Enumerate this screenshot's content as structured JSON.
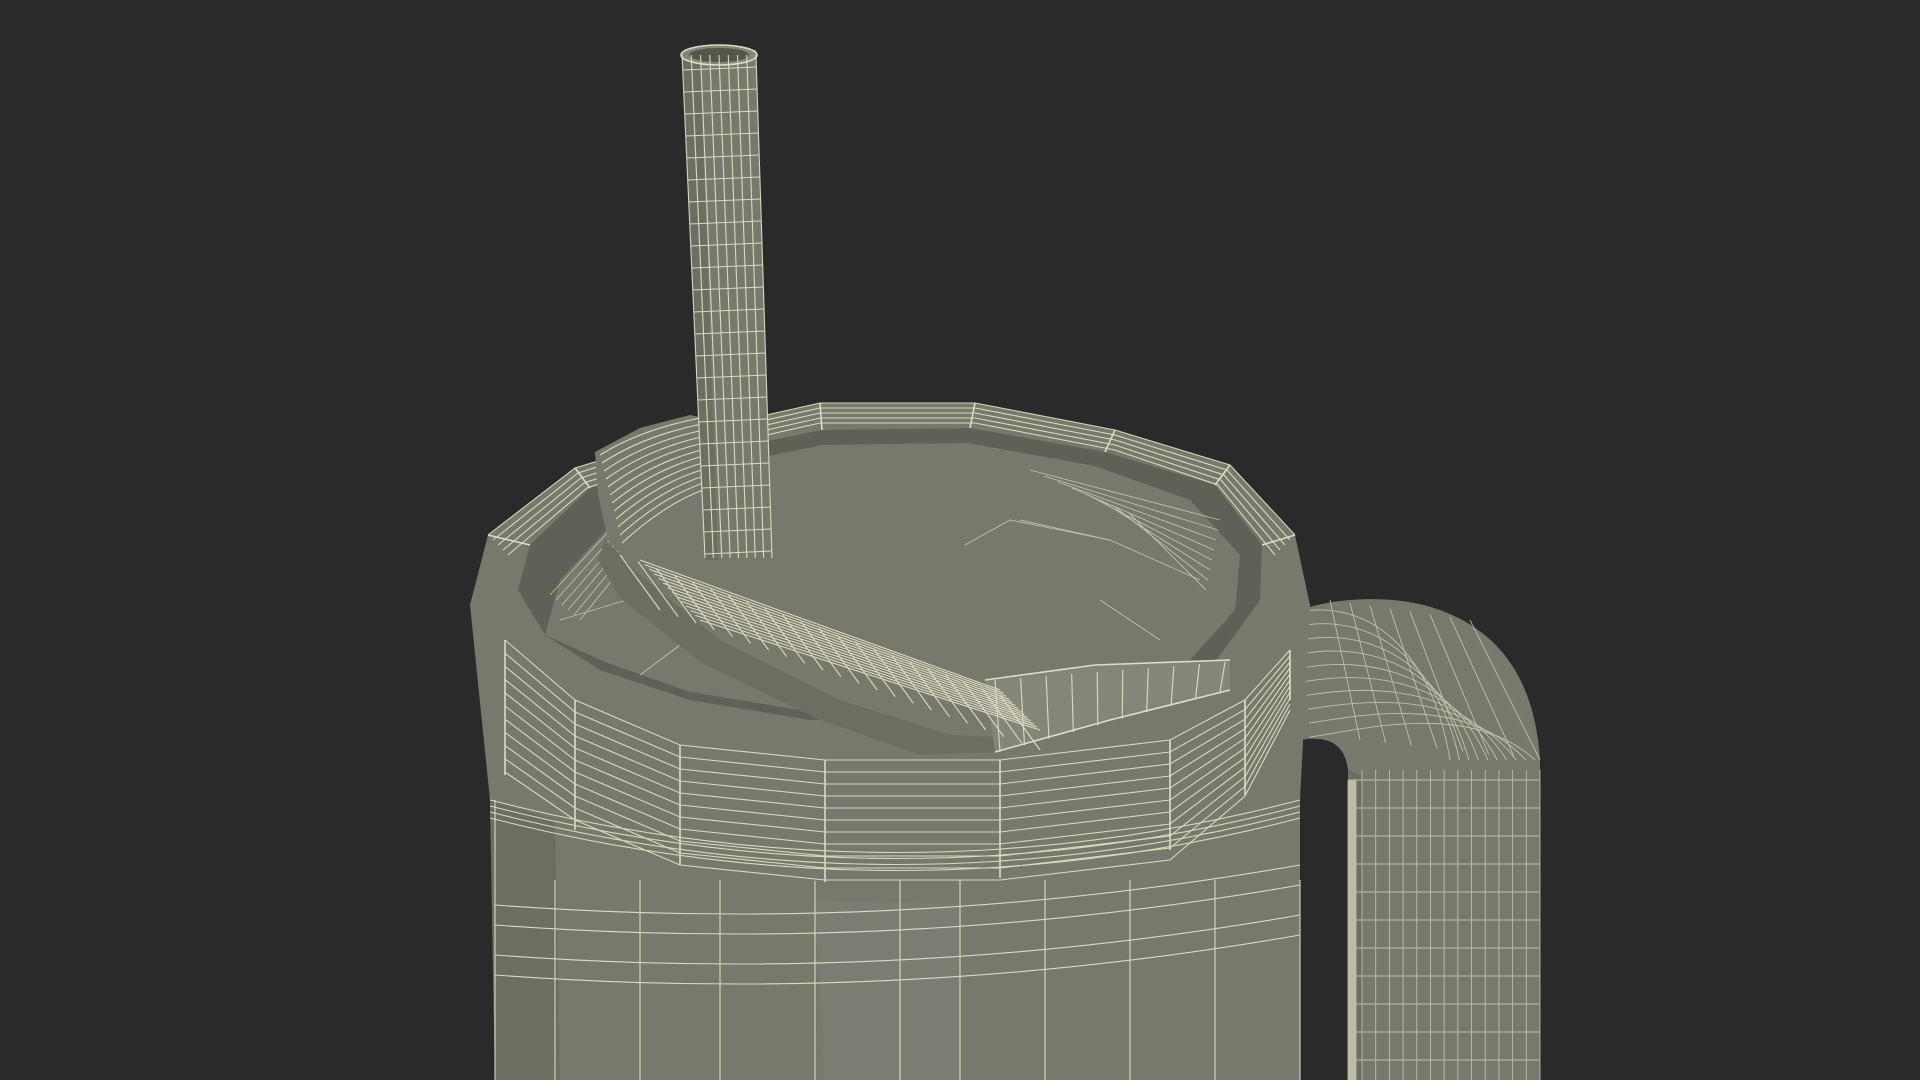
{
  "scene": {
    "background_color": "#2a2a2a",
    "mesh_fill_color": "#78796d",
    "wire_color": "#e6e4c8",
    "subject": "tumbler-with-straw-and-handle-wireframe"
  }
}
